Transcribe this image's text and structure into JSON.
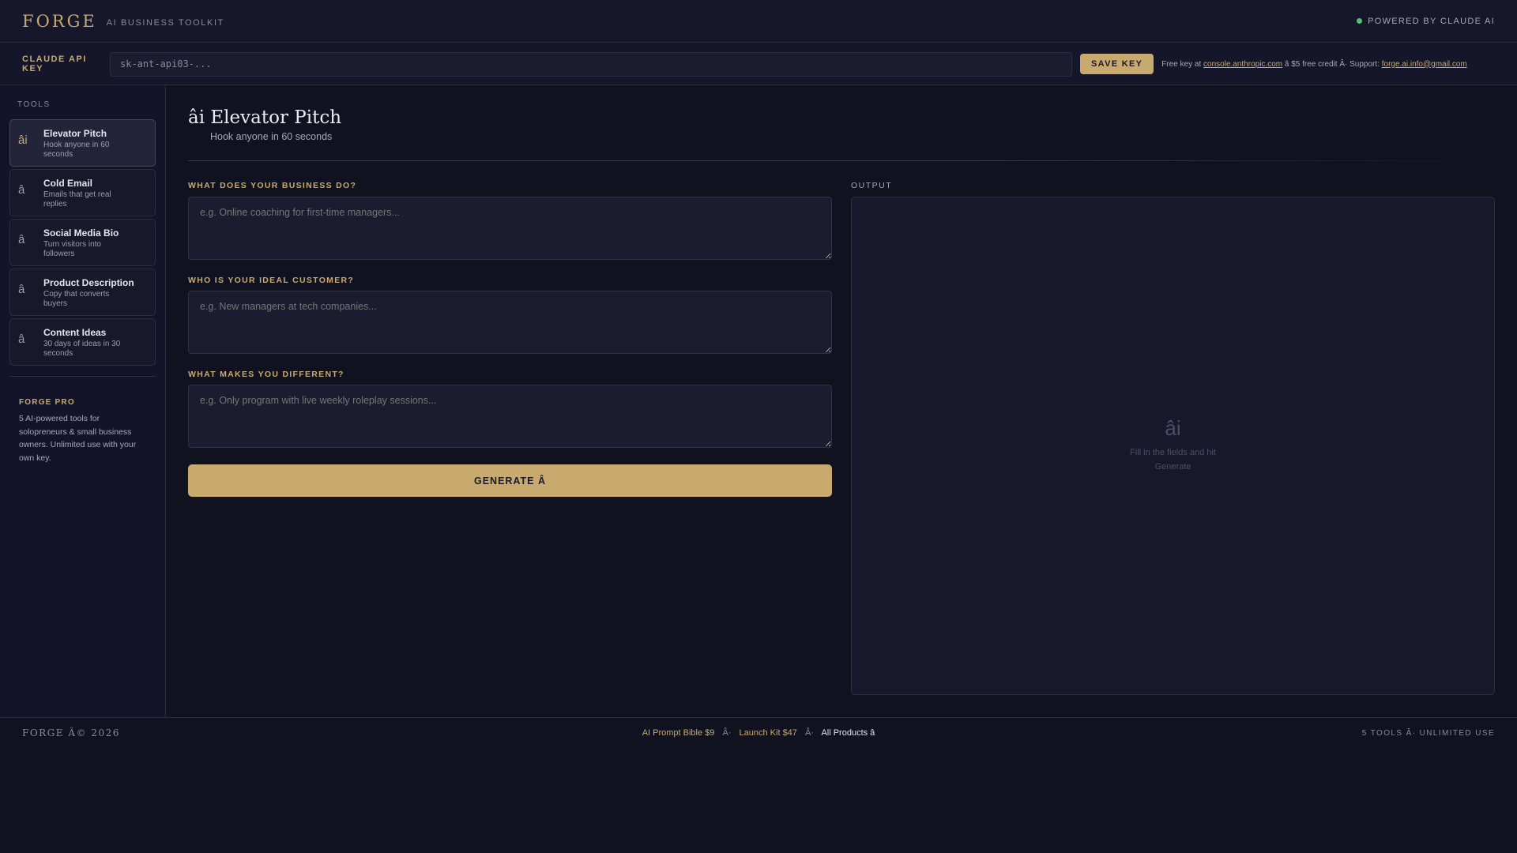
{
  "header": {
    "logo": "FORGE",
    "tagline": "AI BUSINESS TOOLKIT",
    "powered_by": "POWERED BY CLAUDE AI",
    "status_color": "#4ec46e"
  },
  "api_bar": {
    "label": "CLAUDE API KEY",
    "input_value": "sk-ant-api03-...",
    "save_label": "SAVE KEY",
    "note_prefix": "Free key at",
    "console_link": "console.anthropic.com",
    "note_middle": "â $5 free credit Â· Support:",
    "support_link": "forge.ai.info@gmail.com"
  },
  "sidebar": {
    "title": "TOOLS",
    "tools": [
      {
        "icon": "âi",
        "name": "Elevator Pitch",
        "desc": "Hook anyone in 60 seconds",
        "active": true
      },
      {
        "icon": "â",
        "name": "Cold Email",
        "desc": "Emails that get real replies",
        "active": false
      },
      {
        "icon": "â",
        "name": "Social Media Bio",
        "desc": "Turn visitors into followers",
        "active": false
      },
      {
        "icon": "â",
        "name": "Product Description",
        "desc": "Copy that converts buyers",
        "active": false
      },
      {
        "icon": "â",
        "name": "Content Ideas",
        "desc": "30 days of ideas in 30 seconds",
        "active": false
      }
    ],
    "pro": {
      "title": "FORGE PRO",
      "desc": "5 AI-powered tools for solopreneurs & small business owners. Unlimited use with your own key."
    }
  },
  "main": {
    "title_icon": "âi",
    "title": "Elevator Pitch",
    "subtitle": "Hook anyone in 60 seconds",
    "fields": [
      {
        "label": "WHAT DOES YOUR BUSINESS DO?",
        "placeholder": "e.g. Online coaching for first-time managers..."
      },
      {
        "label": "WHO IS YOUR IDEAL CUSTOMER?",
        "placeholder": "e.g. New managers at tech companies..."
      },
      {
        "label": "WHAT MAKES YOU DIFFERENT?",
        "placeholder": "e.g. Only program with live weekly roleplay sessions..."
      }
    ],
    "generate_label": "GENERATE Â",
    "accent_color": "#c8aa6e"
  },
  "output": {
    "label": "OUTPUT",
    "empty_icon": "âi",
    "empty_message": "Fill in the fields and hit Generate"
  },
  "footer": {
    "copyright": "FORGE Â© 2026",
    "links": [
      "AI Prompt Bible $9",
      "Launch Kit $47"
    ],
    "separator": "Â·",
    "all_products": "All Products â",
    "right": "5 TOOLS Â· UNLIMITED USE"
  }
}
